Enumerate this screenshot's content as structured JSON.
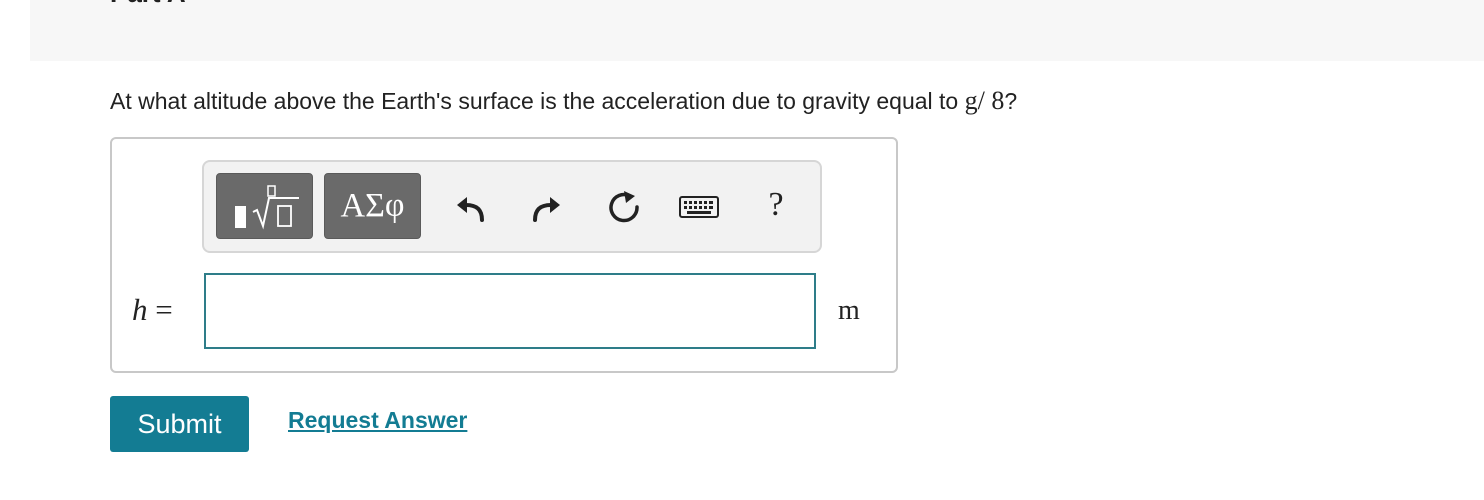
{
  "part": {
    "title": "Part A"
  },
  "question": {
    "text": "At what altitude above the Earth's surface is the acceleration due to gravity equal to ",
    "expression": "g/ 8",
    "end": "?"
  },
  "toolbar": {
    "templates_icon": "templates-sqrt-icon",
    "greek_label": "ΑΣφ",
    "undo_icon": "undo-icon",
    "redo_icon": "redo-icon",
    "reset_icon": "reset-icon",
    "keyboard_icon": "keyboard-icon",
    "help_label": "?"
  },
  "answer": {
    "variable": "h",
    "equals": "=",
    "value": "",
    "unit": "m"
  },
  "actions": {
    "submit_label": "Submit",
    "request_answer_label": "Request Answer"
  },
  "colors": {
    "accent": "#137c93",
    "input_border": "#2e7d89",
    "toolbar_button": "#6a6a6a"
  }
}
